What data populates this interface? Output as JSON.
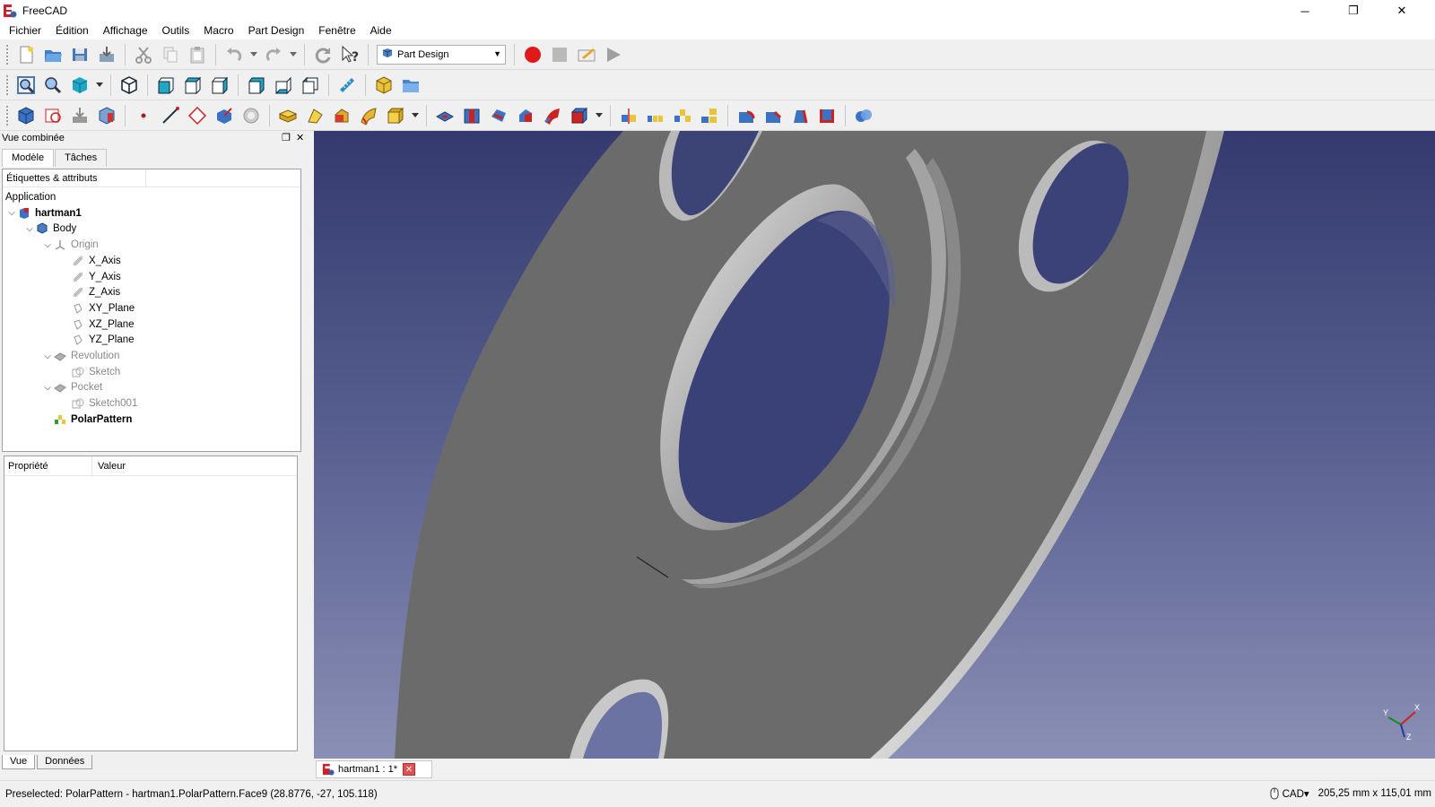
{
  "window": {
    "title": "FreeCAD",
    "minimize": "─",
    "maximize": "❐",
    "close": "✕"
  },
  "menu": [
    "Fichier",
    "Édition",
    "Affichage",
    "Outils",
    "Macro",
    "Part Design",
    "Fenêtre",
    "Aide"
  ],
  "toolbar": {
    "workbench": "Part Design"
  },
  "combo": {
    "title": "Vue combinée",
    "tabs": [
      "Modèle",
      "Tâches"
    ],
    "tree_header": "Étiquettes & attributs",
    "tree": [
      {
        "label": "Application",
        "level": 0,
        "icon": "none",
        "style": "normal",
        "expander": ""
      },
      {
        "label": "hartman1",
        "level": 0,
        "icon": "document-icon",
        "style": "bold",
        "expander": "⌄"
      },
      {
        "label": "Body",
        "level": 1,
        "icon": "body-icon",
        "style": "normal",
        "expander": "⌄"
      },
      {
        "label": "Origin",
        "level": 2,
        "icon": "origin-icon",
        "style": "dim",
        "expander": "⌄"
      },
      {
        "label": "X_Axis",
        "level": 3,
        "icon": "axis-icon",
        "style": "normal",
        "expander": ""
      },
      {
        "label": "Y_Axis",
        "level": 3,
        "icon": "axis-icon",
        "style": "normal",
        "expander": ""
      },
      {
        "label": "Z_Axis",
        "level": 3,
        "icon": "axis-icon",
        "style": "normal",
        "expander": ""
      },
      {
        "label": "XY_Plane",
        "level": 3,
        "icon": "plane-icon",
        "style": "normal",
        "expander": ""
      },
      {
        "label": "XZ_Plane",
        "level": 3,
        "icon": "plane-icon",
        "style": "normal",
        "expander": ""
      },
      {
        "label": "YZ_Plane",
        "level": 3,
        "icon": "plane-icon",
        "style": "normal",
        "expander": ""
      },
      {
        "label": "Revolution",
        "level": 2,
        "icon": "revolution-icon",
        "style": "dim",
        "expander": "⌄"
      },
      {
        "label": "Sketch",
        "level": 3,
        "icon": "sketch-icon",
        "style": "dim",
        "expander": ""
      },
      {
        "label": "Pocket",
        "level": 2,
        "icon": "pocket-icon",
        "style": "dim",
        "expander": "⌄"
      },
      {
        "label": "Sketch001",
        "level": 3,
        "icon": "sketch-icon",
        "style": "dim",
        "expander": ""
      },
      {
        "label": "PolarPattern",
        "level": 2,
        "icon": "polar-pattern-icon",
        "style": "bold",
        "expander": ""
      }
    ],
    "props": {
      "col1": "Propriété",
      "col2": "Valeur"
    },
    "bottom_tabs": [
      "Vue",
      "Données"
    ]
  },
  "doc_tab": {
    "label": "hartman1 : 1*",
    "close": "✕"
  },
  "axis_labels": {
    "x": "X",
    "y": "Y",
    "z": "Z"
  },
  "status": {
    "text": "Preselected: PolarPattern - hartman1.PolarPattern.Face9 (28.8776, -27, 105.118)",
    "nav": "CAD▾",
    "dims": "205,25 mm x 115,01 mm"
  },
  "colors": {
    "viewport_top": "#343a6d",
    "viewport_bottom": "#8a8fb5",
    "part_gray": "#6b6b6b",
    "record_red": "#e0191b"
  }
}
